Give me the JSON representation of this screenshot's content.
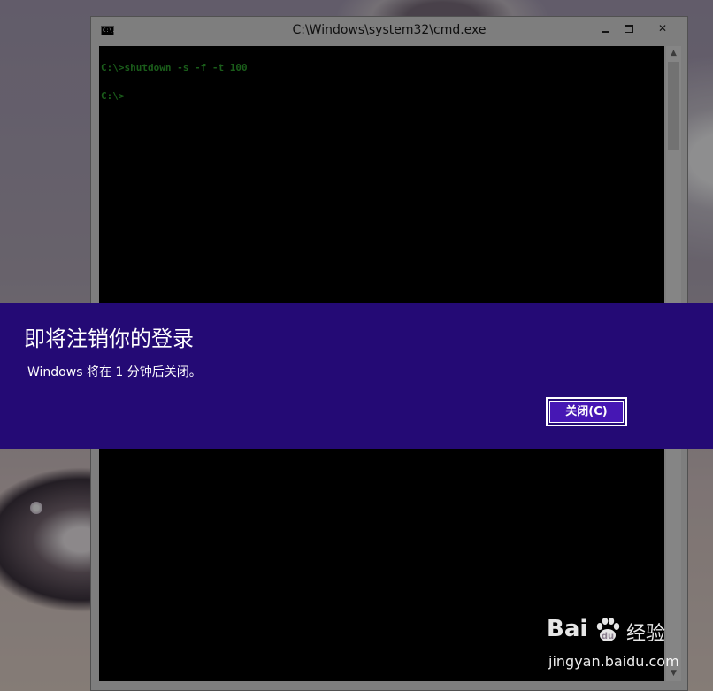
{
  "window": {
    "title": "C:\\Windows\\system32\\cmd.exe",
    "icon_label": "C:\\."
  },
  "console": {
    "lines": [
      "C:\\>shutdown -s -f -t 100",
      "C:\\>"
    ],
    "text_color": "#2ea12e"
  },
  "dialog": {
    "title": "即将注销你的登录",
    "message": "Windows 将在 1 分钟后关闭。",
    "close_button": "关闭(C)",
    "background_color": "#240a75"
  },
  "watermark": {
    "logo": "Bai",
    "logo_suffix": "经验",
    "url": "jingyan.baidu.com"
  },
  "icons": {
    "app": "cmd-icon",
    "minimize": "minimize-icon",
    "maximize": "maximize-icon",
    "close": "close-icon",
    "scroll_up": "scroll-up-icon",
    "scroll_down": "scroll-down-icon",
    "watermark": "baidu-paw-icon"
  }
}
